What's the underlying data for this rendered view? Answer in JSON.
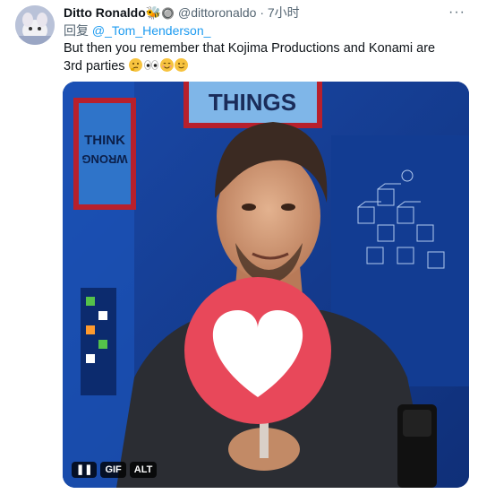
{
  "tweet": {
    "display_name": "Ditto Ronaldo",
    "handle": "@dittoronaldo",
    "separator": "·",
    "time": "7小时",
    "more_label": "···",
    "reply_prefix": "回复",
    "reply_mention": "@_Tom_Henderson_",
    "text": "But then you remember that Kojima Productions and Konami are 3rd parties",
    "text_emojis": [
      "thinking-face",
      "eyes",
      "smiling-face",
      "winking-face"
    ]
  },
  "media": {
    "poster_top_text": "THINGS",
    "poster_left_text_line1": "THINK",
    "poster_left_text_line2": "WRONG",
    "controls": {
      "pause_label": "❚❚",
      "gif_label": "GIF",
      "alt_label": "ALT"
    }
  },
  "colors": {
    "accent": "#1d9bf0",
    "muted": "#536471",
    "heart_sign": "#e8485a"
  }
}
